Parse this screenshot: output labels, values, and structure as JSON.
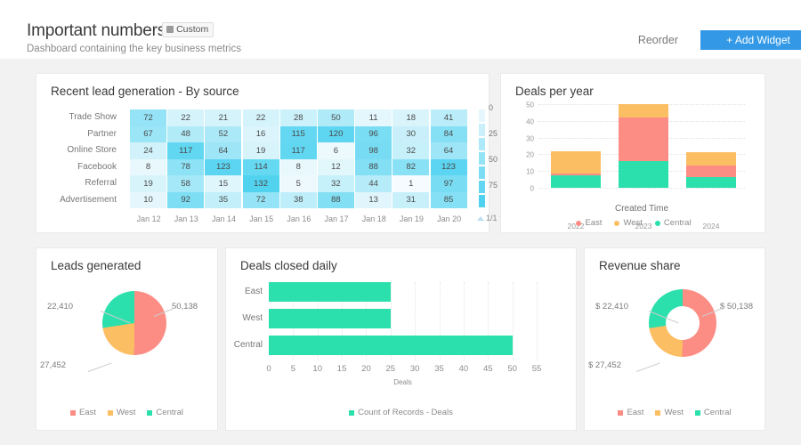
{
  "header": {
    "title": "Important numbers",
    "badge_label": "Custom",
    "badge_icon": "layers-icon",
    "subtitle": "Dashboard containing the key business metrics",
    "reorder_label": "Reorder",
    "add_widget_label": "+ Add Widget",
    "accent_color": "#3399e6"
  },
  "palette": {
    "east": "#FC8D85",
    "west": "#FCBE63",
    "central": "#2BE0AC",
    "heat_low": "#f4fbfe",
    "heat_high": "#4ED2F0"
  },
  "widgets": {
    "heatmap": {
      "title": "Recent lead generation - By source",
      "pager_label": "1/1",
      "chart_data": {
        "type": "heatmap",
        "title": "Recent lead generation - By source",
        "xlabel": "",
        "ylabel": "",
        "categories": [
          "Jan 12",
          "Jan 13",
          "Jan 14",
          "Jan 15",
          "Jan 16",
          "Jan 17",
          "Jan 18",
          "Jan 19",
          "Jan 20"
        ],
        "rows": [
          "Trade Show",
          "Partner",
          "Online Store",
          "Facebook",
          "Referral",
          "Advertisement"
        ],
        "values": [
          [
            72,
            22,
            21,
            22,
            28,
            50,
            11,
            18,
            41
          ],
          [
            67,
            48,
            52,
            16,
            115,
            120,
            96,
            30,
            84
          ],
          [
            24,
            117,
            64,
            19,
            117,
            6,
            98,
            32,
            64
          ],
          [
            8,
            78,
            123,
            114,
            8,
            12,
            88,
            82,
            123
          ],
          [
            19,
            58,
            15,
            132,
            5,
            32,
            44,
            1,
            97
          ],
          [
            10,
            92,
            35,
            72,
            38,
            88,
            13,
            31,
            85
          ]
        ],
        "colorbar_ticks": [
          0,
          25,
          50,
          75
        ],
        "colorbar_range": [
          0,
          100
        ],
        "grid": false
      }
    },
    "deals_per_year": {
      "title": "Deals per year",
      "chart_data": {
        "type": "bar",
        "stacked": true,
        "orientation": "vertical",
        "title": "Deals per year",
        "xlabel": "Created Time",
        "ylabel": "",
        "categories": [
          "2022",
          "2023",
          "2024"
        ],
        "series": [
          {
            "name": "East",
            "values": [
              1,
              26,
              7
            ]
          },
          {
            "name": "West",
            "values": [
              13.5,
              8,
              8
            ]
          },
          {
            "name": "Central",
            "values": [
              7.5,
              16,
              6.5
            ]
          }
        ],
        "totals": [
          22,
          50,
          21.5
        ],
        "ylim": [
          0,
          50
        ],
        "yticks": [
          0,
          10,
          20,
          30,
          40,
          50
        ],
        "grid": true,
        "legend": [
          "East",
          "West",
          "Central"
        ],
        "legend_position": "bottom"
      }
    },
    "leads_generated": {
      "title": "Leads generated",
      "chart_data": {
        "type": "pie",
        "title": "Leads generated",
        "labels": [
          "East",
          "West",
          "Central"
        ],
        "values": [
          50138,
          22410,
          27452
        ],
        "slice_order": [
          "East",
          "West",
          "Central"
        ],
        "callouts": [
          {
            "label": "50,138",
            "series": "East"
          },
          {
            "label": "27,452",
            "series": "West"
          },
          {
            "label": "22,410",
            "series": "Central"
          }
        ],
        "legend": [
          "East",
          "West",
          "Central"
        ],
        "legend_position": "bottom"
      }
    },
    "deals_closed_daily": {
      "title": "Deals closed daily",
      "chart_data": {
        "type": "bar",
        "orientation": "horizontal",
        "title": "Deals closed daily",
        "xlabel": "Deals",
        "ylabel": "",
        "categories": [
          "East",
          "West",
          "Central"
        ],
        "values": [
          25,
          25,
          50
        ],
        "xlim": [
          0,
          55
        ],
        "xticks": [
          0,
          5,
          10,
          15,
          20,
          25,
          30,
          35,
          40,
          45,
          50,
          55
        ],
        "grid": true,
        "legend": [
          "Count of Records - Deals"
        ],
        "legend_position": "bottom"
      }
    },
    "revenue_share": {
      "title": "Revenue share",
      "chart_data": {
        "type": "pie",
        "donut": true,
        "title": "Revenue share",
        "labels": [
          "East",
          "West",
          "Central"
        ],
        "values": [
          50138,
          22410,
          27452
        ],
        "callouts": [
          {
            "label": "$ 50,138",
            "series": "East"
          },
          {
            "label": "$ 27,452",
            "series": "West"
          },
          {
            "label": "$ 22,410",
            "series": "Central"
          }
        ],
        "legend": [
          "East",
          "West",
          "Central"
        ],
        "legend_position": "bottom"
      }
    }
  }
}
